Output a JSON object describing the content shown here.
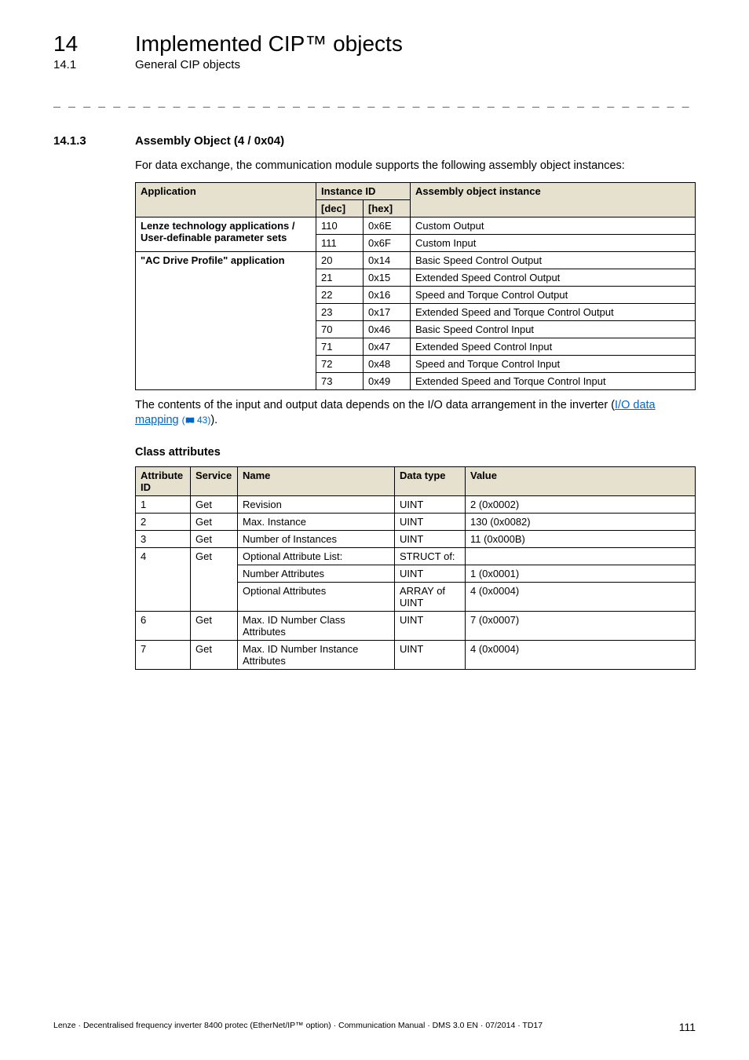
{
  "chapter": {
    "num": "14",
    "title": "Implemented CIP™ objects"
  },
  "subchapter": {
    "num": "14.1",
    "title": "General CIP objects"
  },
  "separator": "_ _ _ _ _ _ _ _ _ _ _ _ _ _ _ _ _ _ _ _ _ _ _ _ _ _ _ _ _ _ _ _ _ _ _ _ _ _ _ _ _ _ _ _ _ _ _ _ _ _ _ _ _ _ _ _ _ _ _ _ _ _ _ _",
  "section": {
    "num": "14.1.3",
    "title": "Assembly Object (4 / 0x04)"
  },
  "intro": "For data exchange, the communication module supports the following assembly object instances:",
  "table1": {
    "headers": {
      "application": "Application",
      "instance_id": "Instance ID",
      "assembly": "Assembly object instance",
      "dec": "[dec]",
      "hex": "[hex]"
    },
    "groups": [
      {
        "label": "Lenze technology applications / User-definable parameter sets",
        "rows": [
          {
            "dec": "110",
            "hex": "0x6E",
            "desc": "Custom Output"
          },
          {
            "dec": "111",
            "hex": "0x6F",
            "desc": "Custom Input"
          }
        ]
      },
      {
        "label": "\"AC Drive Profile\" application",
        "rows": [
          {
            "dec": "20",
            "hex": "0x14",
            "desc": "Basic Speed Control Output"
          },
          {
            "dec": "21",
            "hex": "0x15",
            "desc": "Extended Speed Control Output"
          },
          {
            "dec": "22",
            "hex": "0x16",
            "desc": "Speed and Torque Control Output"
          },
          {
            "dec": "23",
            "hex": "0x17",
            "desc": "Extended Speed and Torque Control Output"
          },
          {
            "dec": "70",
            "hex": "0x46",
            "desc": "Basic Speed Control Input"
          },
          {
            "dec": "71",
            "hex": "0x47",
            "desc": "Extended Speed Control Input"
          },
          {
            "dec": "72",
            "hex": "0x48",
            "desc": "Speed and Torque Control Input"
          },
          {
            "dec": "73",
            "hex": "0x49",
            "desc": "Extended Speed and Torque Control Input"
          }
        ]
      }
    ]
  },
  "note": {
    "pre": "The contents of the input and output data depends on the I/O data arrangement in the inverter (",
    "link": "I/O data mapping",
    "pageref": " 43)",
    "post": ")."
  },
  "class_attr_header": "Class attributes",
  "table2": {
    "headers": {
      "attr": "Attribute ID",
      "service": "Service",
      "name": "Name",
      "datatype": "Data type",
      "value": "Value"
    },
    "rows": [
      {
        "id": "1",
        "svc": "Get",
        "name": "Revision",
        "type": "UINT",
        "val": "2 (0x0002)"
      },
      {
        "id": "2",
        "svc": "Get",
        "name": "Max. Instance",
        "type": "UINT",
        "val": "130 (0x0082)"
      },
      {
        "id": "3",
        "svc": "Get",
        "name": "Number of Instances",
        "type": "UINT",
        "val": "11 (0x000B)"
      }
    ],
    "row4": {
      "id": "4",
      "svc": "Get",
      "name": "Optional Attribute List:",
      "type": "STRUCT of:",
      "sub1_name": "Number Attributes",
      "sub1_type": "UINT",
      "sub1_val": "1 (0x0001)",
      "sub2_name": "Optional Attributes",
      "sub2_type": "ARRAY of UINT",
      "sub2_val": "4 (0x0004)"
    },
    "rows_after": [
      {
        "id": "6",
        "svc": "Get",
        "name": "Max. ID Number Class Attributes",
        "type": "UINT",
        "val": "7 (0x0007)"
      },
      {
        "id": "7",
        "svc": "Get",
        "name": "Max. ID Number Instance Attributes",
        "type": "UINT",
        "val": "4 (0x0004)"
      }
    ]
  },
  "footer": {
    "text": "Lenze · Decentralised frequency inverter 8400 protec (EtherNet/IP™ option) · Communication Manual · DMS 3.0 EN · 07/2014 · TD17",
    "page": "111"
  }
}
